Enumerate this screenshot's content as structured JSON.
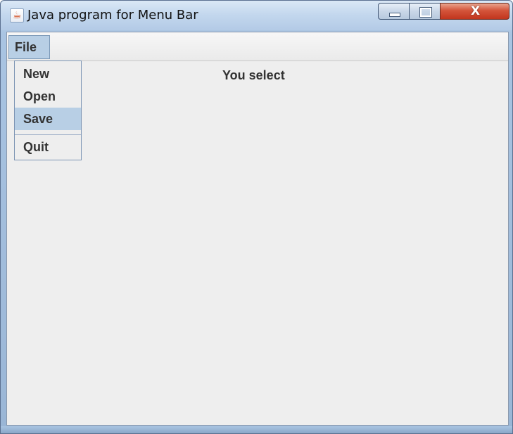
{
  "window": {
    "title": "Java program for Menu Bar",
    "icon": "java-icon",
    "controls": {
      "minimize": "minimize-icon",
      "maximize": "maximize-icon",
      "close_label": "X"
    }
  },
  "menubar": {
    "menus": [
      {
        "label": "File",
        "active": true
      }
    ]
  },
  "file_menu": {
    "items": [
      {
        "label": "New",
        "selected": false
      },
      {
        "label": "Open",
        "selected": false
      },
      {
        "label": "Save",
        "selected": true
      },
      {
        "label": "Quit",
        "selected": false
      }
    ]
  },
  "content": {
    "status_label": "You select"
  },
  "colors": {
    "menu_highlight": "#b8cfe5",
    "client_bg": "#eeeeee",
    "close_button": "#c2351d"
  }
}
